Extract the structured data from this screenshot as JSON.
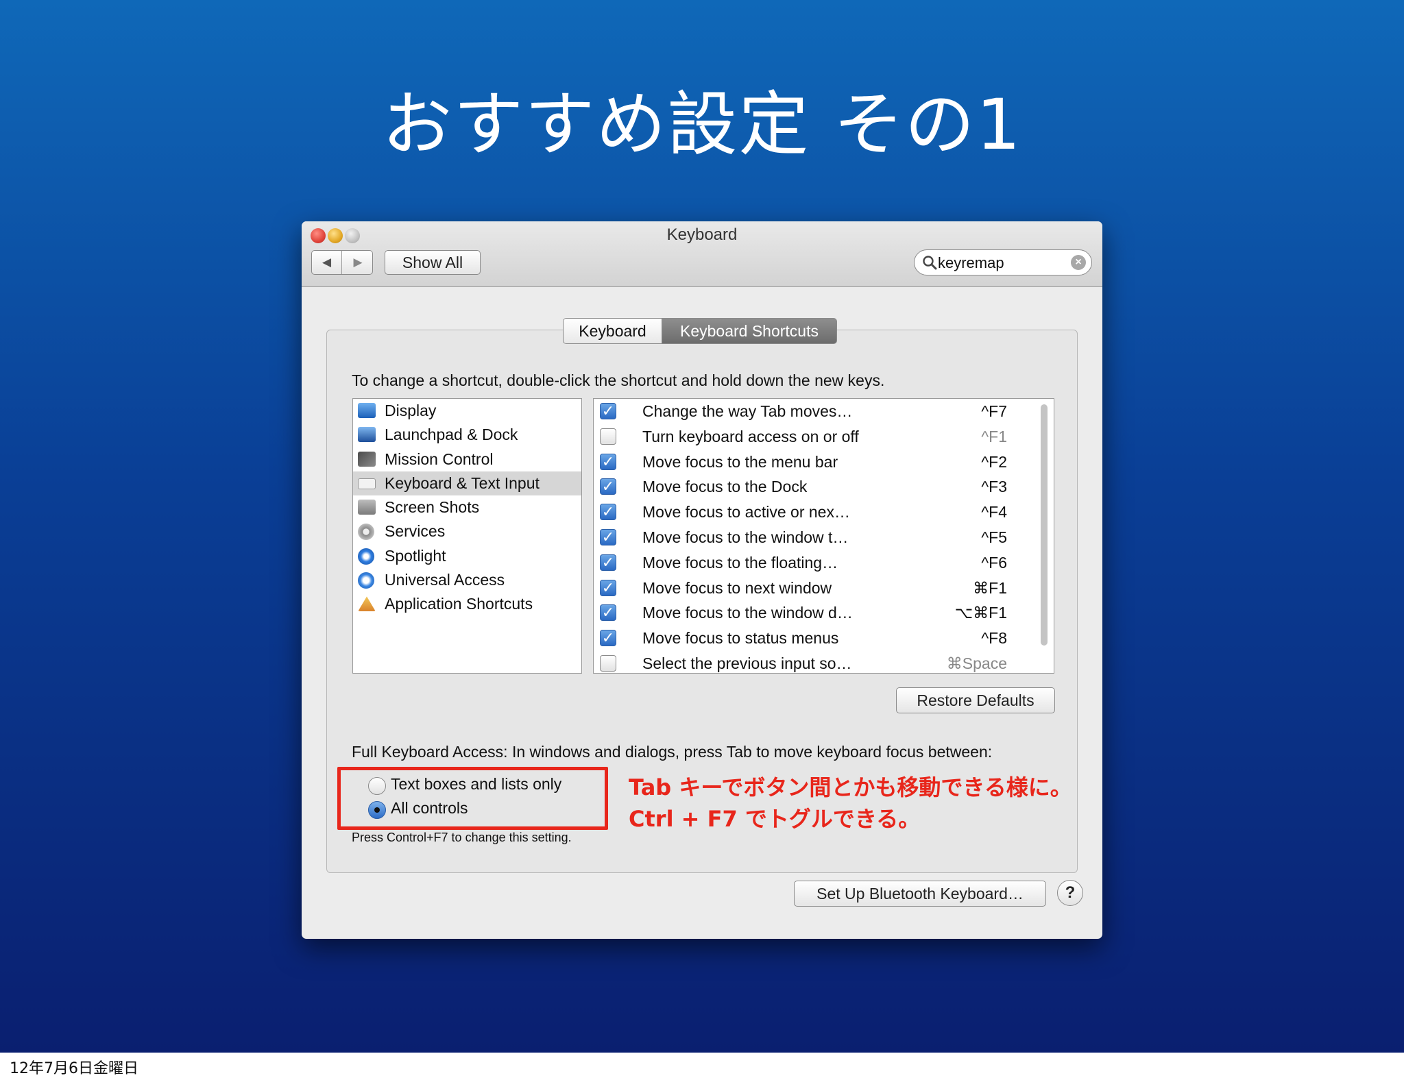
{
  "slide": {
    "title": "おすすめ設定 その1",
    "footer_date": "12年7月6日金曜日"
  },
  "window": {
    "title": "Keyboard",
    "toolbar": {
      "back": "◀",
      "forward": "▶",
      "show_all": "Show All",
      "search_value": "keyremap"
    },
    "tabs": [
      {
        "label": "Keyboard",
        "active": false
      },
      {
        "label": "Keyboard Shortcuts",
        "active": true
      }
    ],
    "instruction": "To change a shortcut, double-click the shortcut and hold down the new keys.",
    "categories": [
      {
        "label": "Display",
        "icon": "display-icon",
        "selected": false
      },
      {
        "label": "Launchpad & Dock",
        "icon": "launchpad-dock-icon",
        "selected": false
      },
      {
        "label": "Mission Control",
        "icon": "mission-control-icon",
        "selected": false
      },
      {
        "label": "Keyboard & Text Input",
        "icon": "keyboard-icon",
        "selected": true
      },
      {
        "label": "Screen Shots",
        "icon": "camera-icon",
        "selected": false
      },
      {
        "label": "Services",
        "icon": "gear-icon",
        "selected": false
      },
      {
        "label": "Spotlight",
        "icon": "spotlight-icon",
        "selected": false
      },
      {
        "label": "Universal Access",
        "icon": "universal-access-icon",
        "selected": false
      },
      {
        "label": "Application Shortcuts",
        "icon": "app-shortcuts-icon",
        "selected": false
      }
    ],
    "shortcuts": [
      {
        "checked": true,
        "label": "Change the way Tab moves…",
        "key": "^F7",
        "dim": false
      },
      {
        "checked": false,
        "label": "Turn keyboard access on or off",
        "key": "^F1",
        "dim": true
      },
      {
        "checked": true,
        "label": "Move focus to the menu bar",
        "key": "^F2",
        "dim": false
      },
      {
        "checked": true,
        "label": "Move focus to the Dock",
        "key": "^F3",
        "dim": false
      },
      {
        "checked": true,
        "label": "Move focus to active or nex…",
        "key": "^F4",
        "dim": false
      },
      {
        "checked": true,
        "label": "Move focus to the window t…",
        "key": "^F5",
        "dim": false
      },
      {
        "checked": true,
        "label": "Move focus to the floating…",
        "key": "^F6",
        "dim": false
      },
      {
        "checked": true,
        "label": "Move focus to next window",
        "key": "⌘F1",
        "dim": false
      },
      {
        "checked": true,
        "label": "Move focus to the window d…",
        "key": "⌥⌘F1",
        "dim": false
      },
      {
        "checked": true,
        "label": "Move focus to status menus",
        "key": "^F8",
        "dim": false
      },
      {
        "checked": false,
        "label": "Select the previous input so…",
        "key": "⌘Space",
        "dim": true
      }
    ],
    "restore_defaults": "Restore Defaults",
    "full_keyboard_access": {
      "text": "Full Keyboard Access: In windows and dialogs, press Tab to move keyboard focus between:",
      "options": [
        {
          "label": "Text boxes and lists only",
          "selected": false
        },
        {
          "label": "All controls",
          "selected": true
        }
      ],
      "note": "Press Control+F7 to change this setting."
    },
    "annotation": {
      "line1": "Tab キーでボタン間とかも移動できる様に。",
      "line2": "Ctrl + F7 でトグルできる。",
      "color": "#e8261b"
    },
    "bluetooth_button": "Set Up Bluetooth Keyboard…",
    "help_button": "?"
  }
}
